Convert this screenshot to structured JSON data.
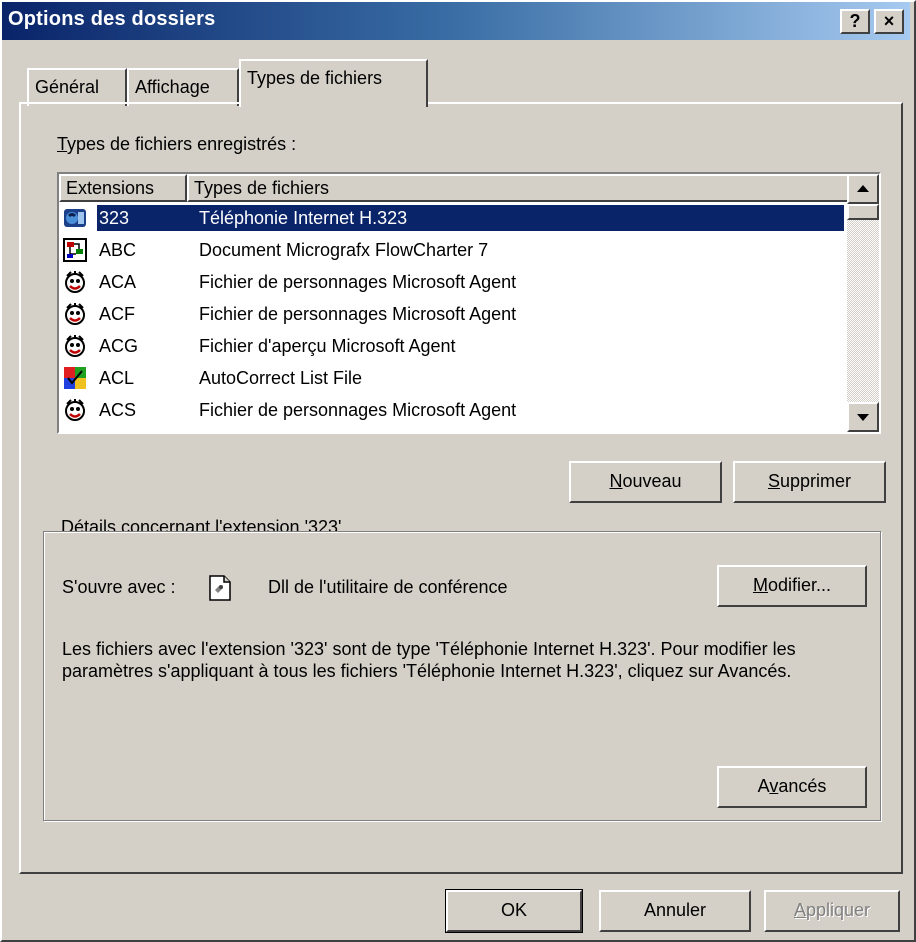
{
  "window": {
    "title": "Options des dossiers",
    "help_button": "?",
    "close_button": "×"
  },
  "tabs": [
    {
      "label": "Général",
      "active": false
    },
    {
      "label": "Affichage",
      "active": false
    },
    {
      "label": "Types de fichiers",
      "active": true
    }
  ],
  "list": {
    "label_hotkey": "T",
    "label_rest": "ypes de fichiers enregistrés :",
    "columns": [
      "Extensions",
      "Types de fichiers"
    ],
    "rows": [
      {
        "ext": "323",
        "type": "Téléphonie Internet H.323",
        "icon": "internet-phone-icon",
        "selected": true
      },
      {
        "ext": "ABC",
        "type": "Document Micrografx FlowCharter 7",
        "icon": "flowchart-doc-icon",
        "selected": false
      },
      {
        "ext": "ACA",
        "type": "Fichier de personnages Microsoft Agent",
        "icon": "agent-character-icon",
        "selected": false
      },
      {
        "ext": "ACF",
        "type": "Fichier de personnages Microsoft Agent",
        "icon": "agent-character-icon",
        "selected": false
      },
      {
        "ext": "ACG",
        "type": "Fichier d'aperçu Microsoft Agent",
        "icon": "agent-character-icon",
        "selected": false
      },
      {
        "ext": "ACL",
        "type": "AutoCorrect List File",
        "icon": "autocorrect-icon",
        "selected": false
      },
      {
        "ext": "ACS",
        "type": "Fichier de personnages Microsoft Agent",
        "icon": "agent-character-icon",
        "selected": false
      }
    ]
  },
  "buttons": {
    "new_hotkey": "N",
    "new_rest": "ouveau",
    "delete_hotkey": "S",
    "delete_rest": "upprimer",
    "modify_hotkey": "M",
    "modify_rest": "odifier...",
    "advanced_pre": "A",
    "advanced_hotkey": "v",
    "advanced_rest": "ancés",
    "ok": "OK",
    "cancel": "Annuler",
    "apply_hotkey": "A",
    "apply_rest": "ppliquer"
  },
  "details": {
    "group_title": "Détails concernant l'extension '323'",
    "opens_with_label": "S'ouvre avec :",
    "opens_with_app": "Dll de l'utilitaire de conférence",
    "description": "Les fichiers avec l'extension '323' sont de type 'Téléphonie Internet H.323'. Pour modifier les paramètres s'appliquant à tous les fichiers 'Téléphonie Internet H.323', cliquez sur Avancés."
  },
  "colors": {
    "face": "#d4d0c8",
    "title_start": "#0a246a",
    "title_end": "#a6caf0",
    "selection": "#0a246a"
  }
}
